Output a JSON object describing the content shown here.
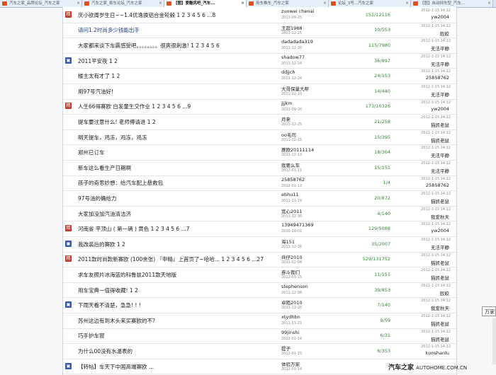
{
  "tabs": [
    {
      "label": "汽车之家_品牌论坛_汽车之家"
    },
    {
      "label": "汽车之家_易车论坛_汽车之家"
    },
    {
      "label": "【图】爱酷风吧_汽车..."
    },
    {
      "label": "用车推车_汽车之家"
    },
    {
      "label": "论坛_3号...汽车之家"
    },
    {
      "label": "【图】自动挡车型_汽车..."
    }
  ],
  "rows": [
    {
      "icon": "flame",
      "title": "庆小欲周岁生日~~1.4优逸换铝合金轮毂 1 2 3 4 5 6 ...8",
      "author": "zuowei chenai",
      "posted": "2011-09-25",
      "counts": "151/12116",
      "last_date": "2012-1-15 14:12",
      "last_user": "yw2004"
    },
    {
      "icon": "",
      "title": "请问1.2时尚多少钱能出手",
      "author": "王超1988",
      "posted": "2011-12-25",
      "counts": "10/553",
      "last_date": "2012-1-15 14:12",
      "last_user": "殴皎"
    },
    {
      "icon": "",
      "title": "大家都来谈下车震感受吧。。。。。。。。很爽很刺激! 1 2 3 4 5 6",
      "author": "dadadada319",
      "posted": "2011-12-20",
      "counts": "115/7980",
      "last_date": "2012-1-15 14:12",
      "last_user": "无法平静"
    },
    {
      "icon": "pic",
      "title": "2011平安夜 1 2",
      "author": "shadow77",
      "posted": "2011-12-24",
      "counts": "36/897",
      "last_date": "2012-1-15 14:12",
      "last_user": "无法平静"
    },
    {
      "icon": "",
      "title": "楼主太有才了 1 2",
      "author": "ddjjch",
      "posted": "2011-12-24",
      "counts": "24/153",
      "last_date": "2012-1-15 14:12",
      "last_user": "25858762"
    },
    {
      "icon": "",
      "title": "用97号汽油好!",
      "author": "大哥保量大帮",
      "posted": "2011-12-10",
      "counts": "14/440",
      "last_date": "2012-1-15 14:12",
      "last_user": "无法平静"
    },
    {
      "icon": "flame",
      "title": "人生66得赛欧 白发童生交作业 1 2 3 4 5 6 ...9",
      "author": "jjjkm",
      "posted": "2011-09-20",
      "counts": "173/10326",
      "last_date": "2012-1-15 14:12",
      "last_user": "yw2004"
    },
    {
      "icon": "",
      "title": "提车要注意什么! 老师傅请进 1 2",
      "author": "月来",
      "posted": "2011-12-25",
      "counts": "21/258",
      "last_date": "2012-1-15 14:12",
      "last_user": "猫抓老鼠"
    },
    {
      "icon": "",
      "title": "明天提车，鸡冻，鸡冻，鸡冻",
      "author": "oo毛司",
      "posted": "2011-12-15",
      "counts": "15/395",
      "last_date": "2012-1-15 14:12",
      "last_user": "猫抓老鼠"
    },
    {
      "icon": "",
      "title": "郑州已订车",
      "author": "赛欧20111114",
      "posted": "2011-12-13",
      "counts": "18/364",
      "last_date": "2012-1-15 14:12",
      "last_user": "无法平静"
    },
    {
      "icon": "",
      "title": "新车这么看生产日期啊",
      "author": "我要么车",
      "posted": "2012-01-11",
      "counts": "15/151",
      "last_date": "2012-1-15 14:12",
      "last_user": "无法平静"
    },
    {
      "icon": "",
      "title": "孩子的奇思妙想：给汽车配上悬救包",
      "author": "25858762",
      "posted": "2012-01-13",
      "counts": "1/4",
      "last_date": "2012-1-15 14:12",
      "last_user": "25858762"
    },
    {
      "icon": "",
      "title": "97号油的确给力",
      "author": "ebhu11",
      "posted": "2011-11-19",
      "counts": "20/872",
      "last_date": "2012-1-15 14:12",
      "last_user": "猫抓老鼠"
    },
    {
      "icon": "",
      "title": "大家加没加汽油清洁济",
      "author": "宽心2011",
      "posted": "2011-12-30",
      "counts": "4/140",
      "last_date": "2012-1-15 14:12",
      "last_user": "我爱秋天"
    },
    {
      "icon": "flame",
      "title": "河南省 平顶山 ( 第一辆 ) 黄色 1 2 3 4 5 6 ...7",
      "author": "13949471369",
      "posted": "2010-10-01",
      "counts": "129/5088",
      "last_date": "2012-1-15 14:12",
      "last_user": "yw2004"
    },
    {
      "icon": "pic",
      "title": "我改装后的赛欧 1 2",
      "author": "海151",
      "posted": "2011-12-26",
      "counts": "35/2007",
      "last_date": "2012-1-15 14:12",
      "last_user": "无法平静"
    },
    {
      "icon": "flame",
      "title": "2011款时尚款新赛欧 (100余张) 『申精』上首页了~哈哈... 1 2 3 4 5 6 ...27",
      "author": "兵仔2010",
      "posted": "2011-02-04",
      "counts": "529/131752",
      "last_date": "2012-1-15 14:12",
      "last_user": "猫抓老鼠"
    },
    {
      "icon": "",
      "title": "求车友照片冰海蓝的科鲁兹2011款天地版",
      "author": "奋斗我们",
      "posted": "2012-01-15",
      "counts": "11/151",
      "last_date": "2012-1-15 14:12",
      "last_user": "猫抓老鼠"
    },
    {
      "icon": "",
      "title": "用车宝典一值得收藏! 1 2",
      "author": "stephenson",
      "posted": "2011-12-08",
      "counts": "39/853",
      "last_date": "2012-1-15 14:12",
      "last_user": "殴皎"
    },
    {
      "icon": "pic",
      "title": "下雨天看不清楚，急急! ! !",
      "author": "卓陌2010",
      "posted": "2011-12-20",
      "counts": "7/140",
      "last_date": "2012-1-15 14:12",
      "last_user": "我爱秋天"
    },
    {
      "icon": "",
      "title": "苏州这边有到木头来买赛欧的不?",
      "author": "xtydhbn",
      "posted": "2011-11-21",
      "counts": "9/59",
      "last_date": "2012-1-15 14:12",
      "last_user": "猫抓老鼠"
    },
    {
      "icon": "",
      "title": "巧手护车窗",
      "author": "99jinshi",
      "posted": "2012-01-14",
      "counts": "6/31",
      "last_date": "2012-1-15 14:12",
      "last_user": "猫抓老鼠"
    },
    {
      "icon": "",
      "title": "为什么00没有水温表的",
      "author": "提子",
      "posted": "2012-01-15",
      "counts": "6/353",
      "last_date": "2012-1-15 14:12",
      "last_user": "kunshanlu"
    },
    {
      "icon": "pic",
      "title": "【转帖】车天下中国高端赛欧 ...",
      "author": "体验万家",
      "posted": "2012-01-14",
      "counts": "",
      "last_date": "",
      "last_user": ""
    }
  ],
  "popup_text": "万家",
  "watermark": {
    "brand": "汽车之家",
    "url": "AUTOHOME.COM.CN"
  }
}
